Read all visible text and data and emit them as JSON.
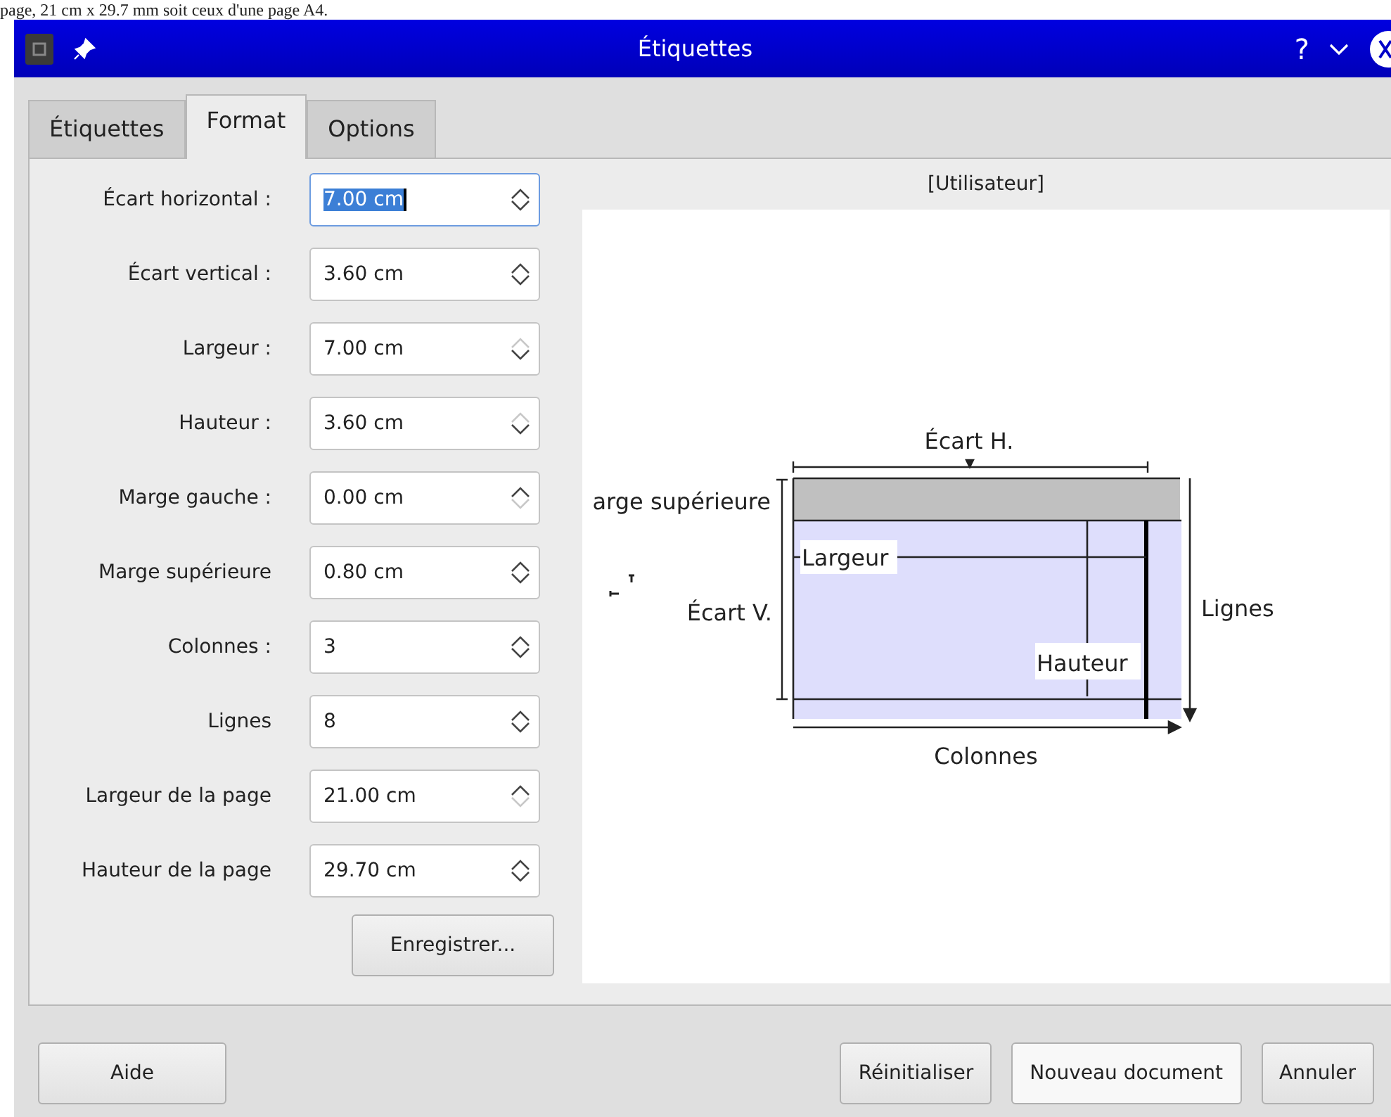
{
  "caption_fragment": "page, 21 cm x 29.7 mm soit ceux d'une page A4.",
  "window": {
    "title": "Étiquettes",
    "help_glyph": "?"
  },
  "tabs": [
    {
      "label": "Étiquettes",
      "selected": false
    },
    {
      "label": "Format",
      "selected": true
    },
    {
      "label": "Options",
      "selected": false
    }
  ],
  "fields": [
    {
      "label": "Écart horizontal :",
      "value": "7.00 cm",
      "focused": true,
      "up_disabled": false,
      "down_disabled": false
    },
    {
      "label": "Écart vertical :",
      "value": "3.60 cm",
      "focused": false,
      "up_disabled": false,
      "down_disabled": false
    },
    {
      "label": "Largeur :",
      "value": "7.00 cm",
      "focused": false,
      "up_disabled": true,
      "down_disabled": false
    },
    {
      "label": "Hauteur :",
      "value": "3.60 cm",
      "focused": false,
      "up_disabled": true,
      "down_disabled": false
    },
    {
      "label": "Marge gauche :",
      "value": "0.00 cm",
      "focused": false,
      "up_disabled": false,
      "down_disabled": true
    },
    {
      "label": "Marge supérieure",
      "value": "0.80 cm",
      "focused": false,
      "up_disabled": false,
      "down_disabled": false
    },
    {
      "label": "Colonnes :",
      "value": "3",
      "focused": false,
      "up_disabled": false,
      "down_disabled": false
    },
    {
      "label": "Lignes",
      "value": "8",
      "focused": false,
      "up_disabled": false,
      "down_disabled": false
    },
    {
      "label": "Largeur de la page",
      "value": "21.00 cm",
      "focused": false,
      "up_disabled": false,
      "down_disabled": true
    },
    {
      "label": "Hauteur de la page",
      "value": "29.70 cm",
      "focused": false,
      "up_disabled": false,
      "down_disabled": false
    }
  ],
  "save_button": "Enregistrer...",
  "preview": {
    "title": "[Utilisateur]",
    "ecart_h": "Écart H.",
    "marge_sup": "arge supérieure",
    "ecart_v": "Écart V.",
    "largeur": "Largeur",
    "hauteur": "Hauteur",
    "lignes": "Lignes",
    "colonnes": "Colonnes"
  },
  "buttons": [
    {
      "label": "Aide",
      "default": false
    },
    {
      "label": "Réinitialiser",
      "default": false
    },
    {
      "label": "Nouveau document",
      "default": true
    },
    {
      "label": "Annuler",
      "default": false
    }
  ]
}
